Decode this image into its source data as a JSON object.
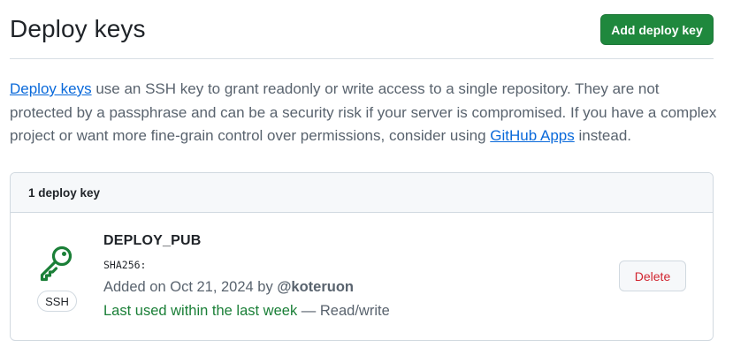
{
  "header": {
    "title": "Deploy keys",
    "add_button_label": "Add deploy key"
  },
  "description": {
    "link_deploy_keys": "Deploy keys",
    "text_1": " use an SSH key to grant readonly or write access to a single repository. They are not protected by a passphrase and can be a security risk if your server is compromised. If you have a complex project or want more fine-grain control over permissions, consider using ",
    "link_github_apps": "GitHub Apps",
    "text_2": " instead."
  },
  "keys_box": {
    "count_label": "1 deploy key",
    "keys": [
      {
        "icon": "key-icon",
        "badge": "SSH",
        "title": "DEPLOY_PUB",
        "fingerprint": "SHA256:",
        "added_prefix": "Added on Oct 21, 2024 by ",
        "added_by": "@koteruon",
        "last_used": "Last used within the last week",
        "access": " — Read/write",
        "delete_label": "Delete"
      }
    ]
  },
  "colors": {
    "primary_button": "#1f883d",
    "link": "#0969da",
    "recent_usage": "#1a7f37",
    "key_icon": "#1a7f37",
    "danger": "#d1242f"
  }
}
